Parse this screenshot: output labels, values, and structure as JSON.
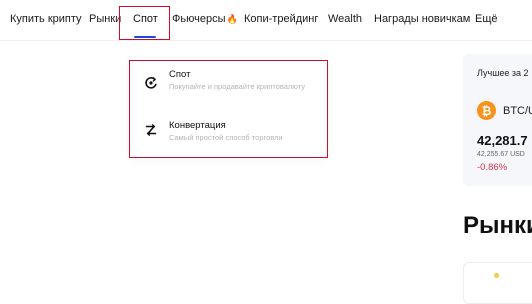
{
  "nav": {
    "items": [
      {
        "label": "Купить крипту"
      },
      {
        "label": "Рынки"
      },
      {
        "label": "Спот"
      },
      {
        "label": "Фьючерсы"
      },
      {
        "label": "Копи-трейдинг"
      },
      {
        "label": "Wealth"
      },
      {
        "label": "Награды новичкам"
      },
      {
        "label": "Ещё"
      }
    ],
    "active": "Спот"
  },
  "dropdown": {
    "items": [
      {
        "title": "Спот",
        "description": "Покупайте и продавайте криптовалюту",
        "icon": "spot-icon"
      },
      {
        "title": "Конвертация",
        "description": "Самый простой способ торговли",
        "icon": "convert-icon"
      }
    ]
  },
  "card": {
    "title": "Лучшее за 2",
    "pair": "BTC/U",
    "price": "42,281.7",
    "sub_price": "42,255.67 USD",
    "change": "-0.86%",
    "icon": "bitcoin-icon"
  },
  "markets": {
    "heading": "Рынки"
  },
  "colors": {
    "accent": "#1d4ed8",
    "highlight": "#c8102e",
    "negative": "#e0314b",
    "bitcoin": "#f7931a"
  }
}
